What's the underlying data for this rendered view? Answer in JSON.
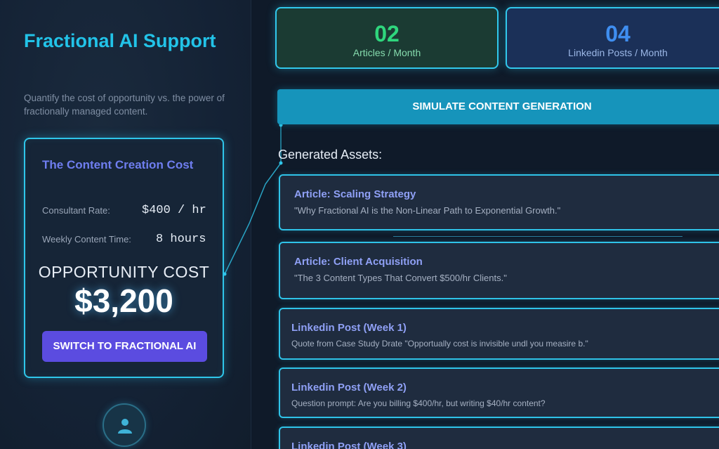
{
  "sidebar": {
    "title": "Fractional AI Support",
    "subtitle": "Quantify the cost of opportunity vs. the power of fractionally managed content.",
    "card": {
      "title": "The Content Creation Cost",
      "rate_label": "Consultant Rate:",
      "rate_value": "$400 / hr",
      "time_label": "Weekly Content Time:",
      "time_value": "8 hours",
      "opportunity_label": "OPPORTUNITY COST",
      "opportunity_value": "$3,200",
      "switch_button": "SWITCH TO FRACTIONAL AI"
    },
    "avatar_icon": "user-icon"
  },
  "stats": [
    {
      "value": "02",
      "label": "Articles / Month",
      "color": "#2fd67d"
    },
    {
      "value": "04",
      "label": "Linkedin Posts / Month",
      "color": "#3f8ef0"
    }
  ],
  "simulate_button": "SIMULATE CONTENT GENERATION",
  "assets_heading": "Generated Assets:",
  "assets": [
    {
      "title": "Article: Scaling Strategy",
      "desc": "\"Why Fractional AI is the Non-Linear Path to Exponential Growth.\""
    },
    {
      "title": "Article: Client Acquisition",
      "desc": "\"The 3 Content Types That Convert $500/hr Clients.\""
    },
    {
      "title": "Linkedin Post (Week 1)",
      "desc": "Quote from Case Study Drate \"Opportually cost is invisible undl you measire b.\""
    },
    {
      "title": "Linkedin Post (Week 2)",
      "desc": "Question prompt: Are you billing $400/hr, but writing $40/hr content?"
    },
    {
      "title": "Linkedin Post (Week 3)",
      "desc": ""
    }
  ],
  "colors": {
    "accent": "#2fc6ea",
    "button": "#5b4ce0",
    "simulate": "#1694bb",
    "background": "#0f1a29"
  }
}
